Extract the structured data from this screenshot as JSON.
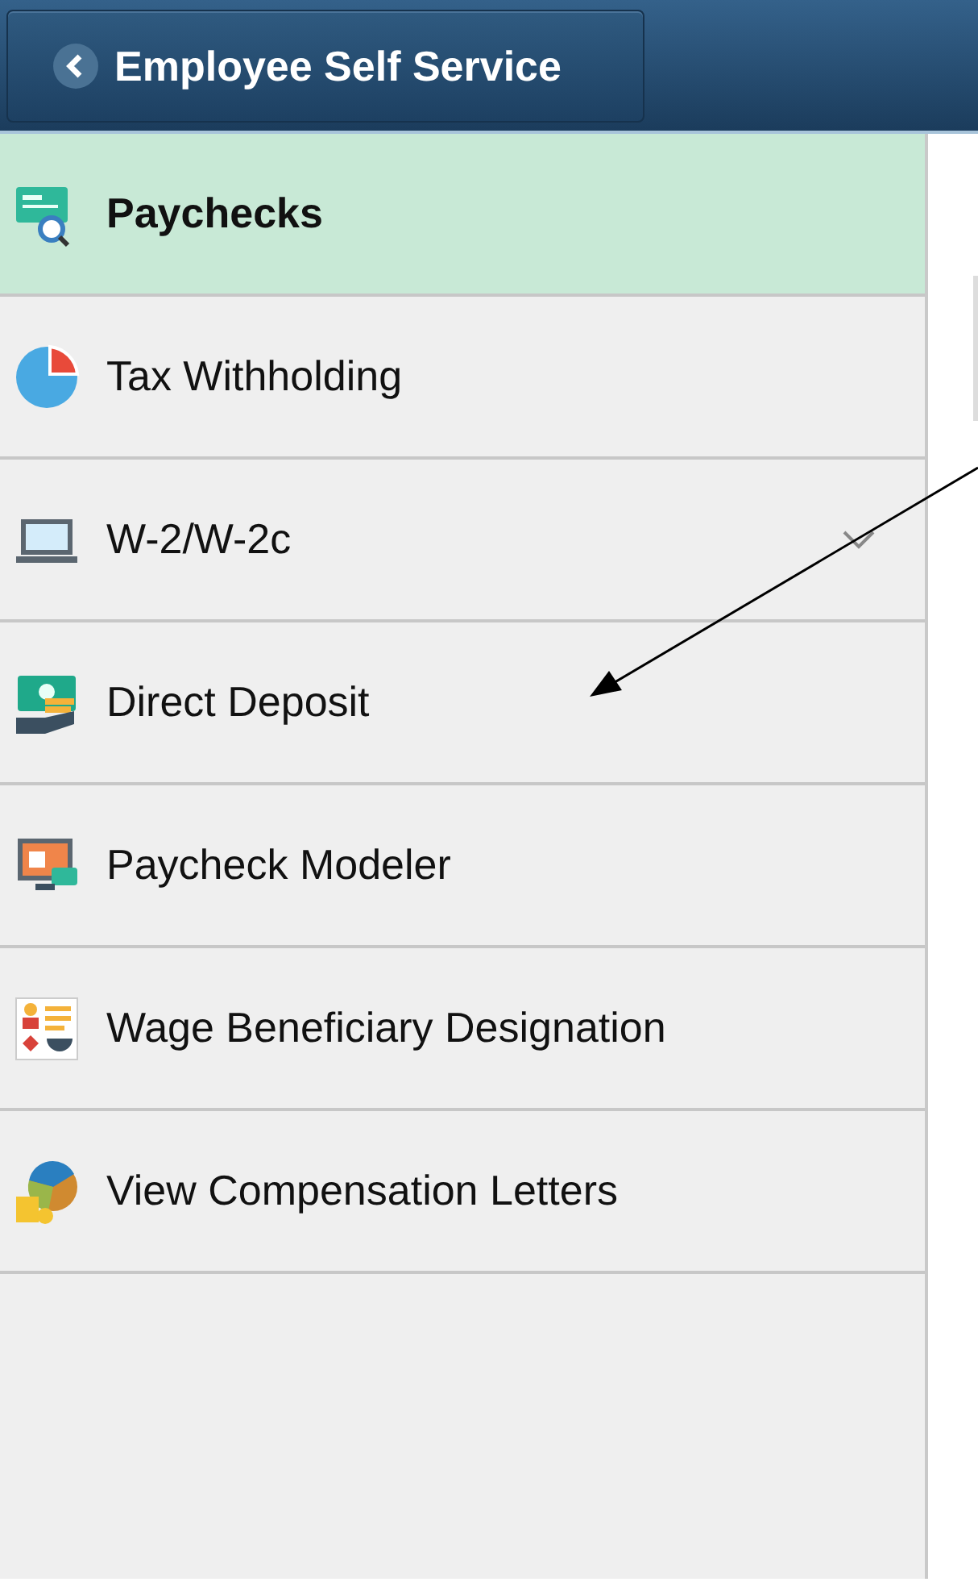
{
  "header": {
    "back_label": "Employee Self Service"
  },
  "sidebar": {
    "items": [
      {
        "label": "Paychecks",
        "selected": true
      },
      {
        "label": "Tax Withholding",
        "selected": false
      },
      {
        "label": "W-2/W-2c",
        "selected": false,
        "kind": "expandable"
      },
      {
        "label": "Direct Deposit",
        "selected": false
      },
      {
        "label": "Paycheck Modeler",
        "selected": false
      },
      {
        "label": "Wage Beneficiary Designation",
        "selected": false
      },
      {
        "label": "View Compensation Letters",
        "selected": false
      }
    ]
  }
}
